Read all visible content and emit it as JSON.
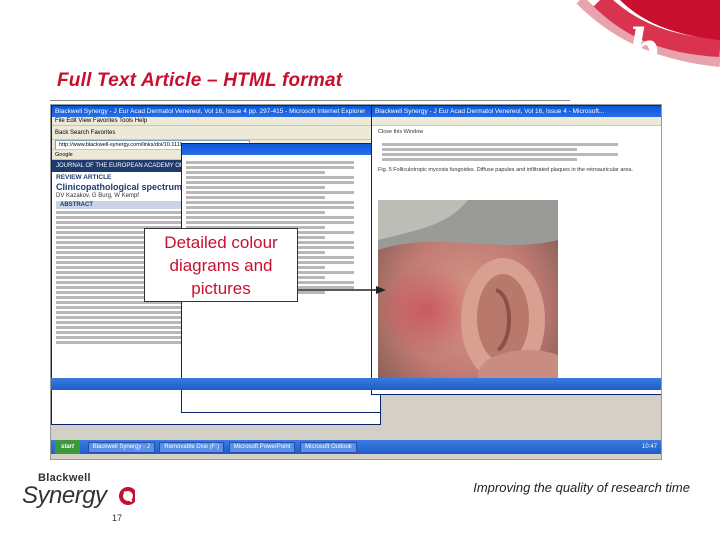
{
  "slide": {
    "title": "Full Text Article – HTML format",
    "callout_line1": "Detailed colour",
    "callout_line2": "diagrams and",
    "callout_line3": "pictures",
    "tagline": "Improving the quality of research time",
    "page_number": "17",
    "logo_top": "Blackwell",
    "logo_bottom": "Synergy"
  },
  "colors": {
    "accent_red": "#c8102e",
    "text_dark": "#333333",
    "xp_blue": "#0a58d8"
  },
  "screenshot": {
    "main_window": {
      "title": "Blackwell Synergy - J Eur Acad Dermatol Venereol, Vol 16, Issue 4 pp. 297-415 - Microsoft Internet Explorer",
      "menu": "File   Edit   View   Favorites   Tools   Help",
      "toolbar": "Back   Search   Favorites",
      "address": "http://www.blackwell-synergy.com/links/doi/10.1111",
      "google_label": "Google",
      "journal_label": "JOURNAL OF THE EUROPEAN ACADEMY OF DERMATOLOGY AND VENEREOLOGY",
      "article_type": "REVIEW ARTICLE",
      "article_title": "Clinicopathological spectrum of myco",
      "authors": "DV Kazakov, G Burg, W Kempf",
      "abstract_heading": "ABSTRACT"
    },
    "figure_window": {
      "title": "Blackwell Synergy - J Eur Acad Dermatol Venereol, Vol 16, Issue 4 - Microsoft...",
      "close_label": "Close this Window",
      "caption": "Fig. 5 Folliculotropic mycosis fungoides. Diffuse papules and infiltrated plaques in the retroauricular area."
    },
    "taskbar": {
      "start": "start",
      "tasks": [
        "Blackwell Synergy - J",
        "Removable Disk (F:)",
        "Microsoft PowerPoint",
        "Microsoft Outlook"
      ],
      "clock": "10:47"
    }
  }
}
